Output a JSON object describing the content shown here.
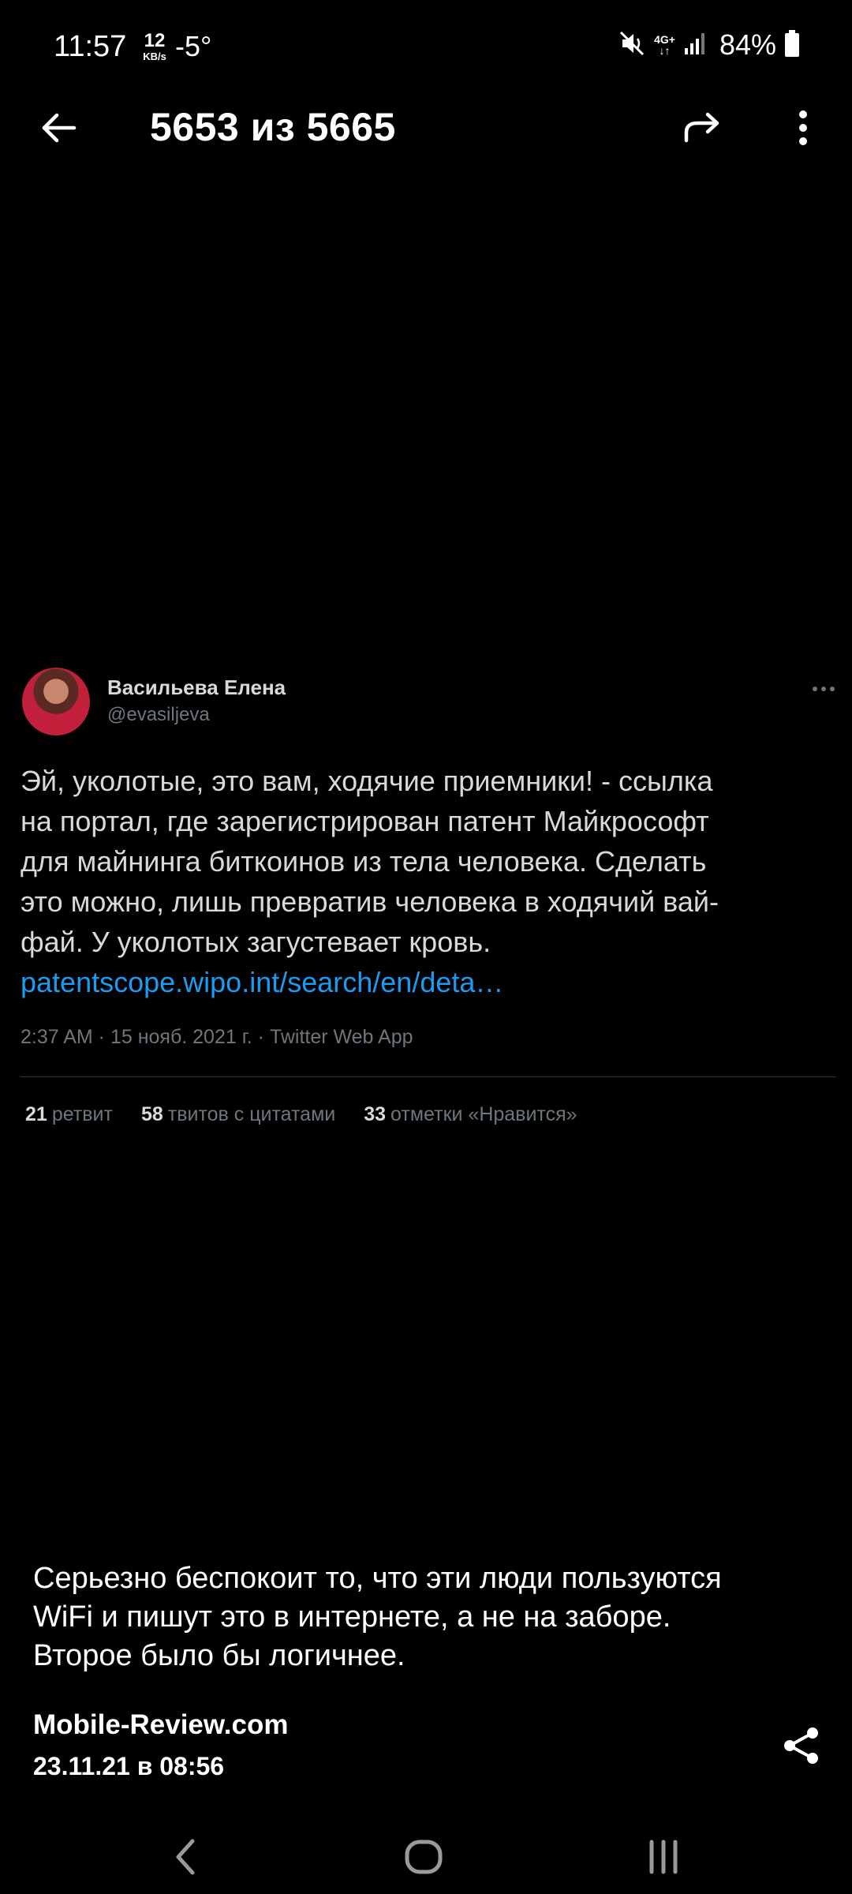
{
  "status_bar": {
    "time": "11:57",
    "speed_value": "12",
    "speed_unit": "KB/s",
    "temperature": "-5°",
    "network": "4G+",
    "battery": "84%",
    "icons": [
      "mute-icon",
      "network-4g-icon",
      "signal-icon",
      "battery-icon"
    ]
  },
  "app_bar": {
    "title": "5653 из 5665",
    "icons": [
      "back-arrow-icon",
      "forward-share-icon",
      "more-vert-icon"
    ]
  },
  "tweet": {
    "author_name": "Васильева Елена",
    "author_handle": "@evasiljeva",
    "text_lines": [
      "Эй, уколотые, это вам, ходячие приемники! - ссылка",
      "на портал, где зарегистрирован патент Майкрософт",
      "для майнинга биткоинов из тела человека. Сделать",
      "это можно, лишь превратив человека в ходячий вай-",
      "фай. У уколотых загустевает кровь."
    ],
    "link": "patentscope.wipo.int/search/en/deta…",
    "meta": "2:37 AM · 15 нояб. 2021 г. · Twitter Web App",
    "stats": {
      "retweets_count": "21",
      "retweets_label": "ретвит",
      "quotes_count": "58",
      "quotes_label": "твитов с цитатами",
      "likes_count": "33",
      "likes_label": "отметки «Нравится»"
    }
  },
  "caption": {
    "lines": [
      "Серьезно беспокоит то, что эти люди пользуются",
      "WiFi и пишут это в интернете, а не на заборе.",
      "Второе было бы логичнее."
    ],
    "source": "Mobile-Review.com",
    "date": "23.11.21 в 08:56"
  },
  "colors": {
    "background": "#000000",
    "tweet_text": "#d9d9d9",
    "tweet_secondary": "#6e767d",
    "link": "#1d9bf0"
  }
}
